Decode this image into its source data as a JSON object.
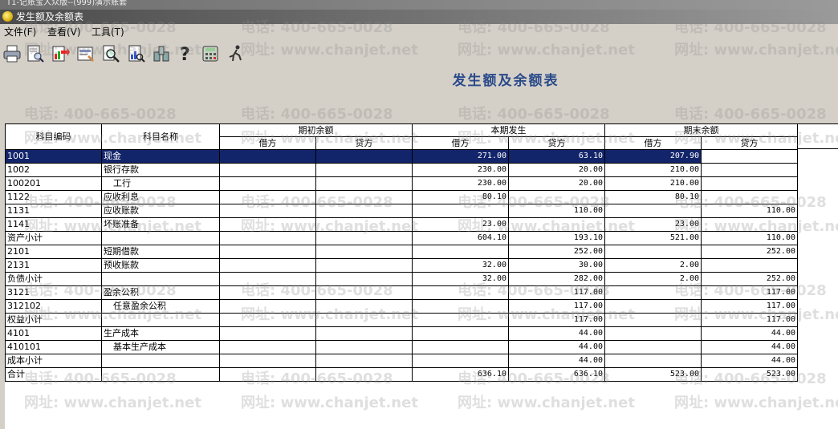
{
  "window": {
    "title": "T1-记账宝人众版--(999)演示账套",
    "subtitle": "发生额及余额表"
  },
  "menu": [
    {
      "label": "文件(F)"
    },
    {
      "label": "查看(V)"
    },
    {
      "label": "工具(T)"
    }
  ],
  "toolbar": [
    {
      "icon": "print-icon"
    },
    {
      "icon": "print-preview-icon"
    },
    {
      "icon": "export-icon"
    },
    {
      "icon": "page-setup-icon"
    },
    {
      "icon": "find-icon"
    },
    {
      "icon": "detail-icon"
    },
    {
      "icon": "filter-icon"
    },
    {
      "icon": "help-icon"
    },
    {
      "icon": "calculator-icon"
    },
    {
      "icon": "exit-icon"
    }
  ],
  "report": {
    "title": "发生额及余额表"
  },
  "table": {
    "headers": {
      "code": "科目编码",
      "name": "科目名称",
      "opening": "期初余额",
      "period": "本期发生",
      "closing": "期末余额",
      "debit": "借方",
      "credit": "贷方"
    },
    "rows": [
      {
        "code": "1001",
        "name": "现金",
        "indent": false,
        "od": "",
        "oc": "",
        "pd": "271.00",
        "pc": "63.10",
        "cd": "207.90",
        "cc": "",
        "selected": true
      },
      {
        "code": "1002",
        "name": "银行存款",
        "indent": false,
        "od": "",
        "oc": "",
        "pd": "230.00",
        "pc": "20.00",
        "cd": "210.00",
        "cc": ""
      },
      {
        "code": "100201",
        "name": "工行",
        "indent": true,
        "od": "",
        "oc": "",
        "pd": "230.00",
        "pc": "20.00",
        "cd": "210.00",
        "cc": ""
      },
      {
        "code": "1122",
        "name": "应收利息",
        "indent": false,
        "od": "",
        "oc": "",
        "pd": "80.10",
        "pc": "",
        "cd": "80.10",
        "cc": ""
      },
      {
        "code": "1131",
        "name": "应收账款",
        "indent": false,
        "od": "",
        "oc": "",
        "pd": "",
        "pc": "110.00",
        "cd": "",
        "cc": "110.00"
      },
      {
        "code": "1141",
        "name": "坏账准备",
        "indent": false,
        "od": "",
        "oc": "",
        "pd": "23.00",
        "pc": "",
        "cd": "23.00",
        "cc": ""
      },
      {
        "code": "资产小计",
        "name": "",
        "indent": false,
        "od": "",
        "oc": "",
        "pd": "604.10",
        "pc": "193.10",
        "cd": "521.00",
        "cc": "110.00"
      },
      {
        "code": "2101",
        "name": "短期借款",
        "indent": false,
        "od": "",
        "oc": "",
        "pd": "",
        "pc": "252.00",
        "cd": "",
        "cc": "252.00"
      },
      {
        "code": "2131",
        "name": "预收账款",
        "indent": false,
        "od": "",
        "oc": "",
        "pd": "32.00",
        "pc": "30.00",
        "cd": "2.00",
        "cc": ""
      },
      {
        "code": "负债小计",
        "name": "",
        "indent": false,
        "od": "",
        "oc": "",
        "pd": "32.00",
        "pc": "282.00",
        "cd": "2.00",
        "cc": "252.00"
      },
      {
        "code": "3121",
        "name": "盈余公积",
        "indent": false,
        "od": "",
        "oc": "",
        "pd": "",
        "pc": "117.00",
        "cd": "",
        "cc": "117.00"
      },
      {
        "code": "312102",
        "name": "任意盈余公积",
        "indent": true,
        "od": "",
        "oc": "",
        "pd": "",
        "pc": "117.00",
        "cd": "",
        "cc": "117.00"
      },
      {
        "code": "权益小计",
        "name": "",
        "indent": false,
        "od": "",
        "oc": "",
        "pd": "",
        "pc": "117.00",
        "cd": "",
        "cc": "117.00"
      },
      {
        "code": "4101",
        "name": "生产成本",
        "indent": false,
        "od": "",
        "oc": "",
        "pd": "",
        "pc": "44.00",
        "cd": "",
        "cc": "44.00"
      },
      {
        "code": "410101",
        "name": "基本生产成本",
        "indent": true,
        "od": "",
        "oc": "",
        "pd": "",
        "pc": "44.00",
        "cd": "",
        "cc": "44.00"
      },
      {
        "code": "成本小计",
        "name": "",
        "indent": false,
        "od": "",
        "oc": "",
        "pd": "",
        "pc": "44.00",
        "cd": "",
        "cc": "44.00"
      },
      {
        "code": "合计",
        "name": "",
        "indent": false,
        "od": "",
        "oc": "",
        "pd": "636.10",
        "pc": "636.10",
        "cd": "523.00",
        "cc": "523.00"
      }
    ]
  },
  "watermark": {
    "phone": "电话: 400-665-0028",
    "site": "网址: www.chanjet.net"
  },
  "colors": {
    "selection": "#12246a",
    "title": "#2a4a8a"
  }
}
